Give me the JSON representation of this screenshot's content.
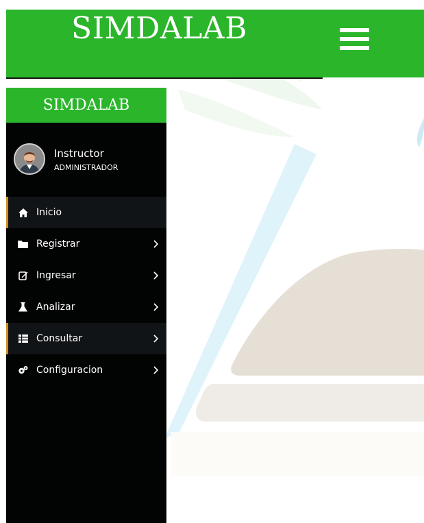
{
  "header": {
    "brand": "SIMDALAB"
  },
  "sidebar": {
    "brand": "SIMDALAB",
    "user": {
      "name": "Instructor",
      "role": "ADMINISTRADOR"
    },
    "items": [
      {
        "label": "Inicio",
        "icon": "home-icon",
        "active": true,
        "has_submenu": false
      },
      {
        "label": "Registrar",
        "icon": "folder-icon",
        "active": false,
        "has_submenu": true
      },
      {
        "label": "Ingresar",
        "icon": "edit-icon",
        "active": false,
        "has_submenu": true
      },
      {
        "label": "Analizar",
        "icon": "flask-icon",
        "active": false,
        "has_submenu": true
      },
      {
        "label": "Consultar",
        "icon": "table-icon",
        "active": true,
        "has_submenu": true
      },
      {
        "label": "Configuracion",
        "icon": "gears-icon",
        "active": false,
        "has_submenu": true
      }
    ]
  },
  "colors": {
    "brand_green": "#2ab52a",
    "sidebar_bg": "#020303",
    "active_accent": "#d08a24"
  }
}
